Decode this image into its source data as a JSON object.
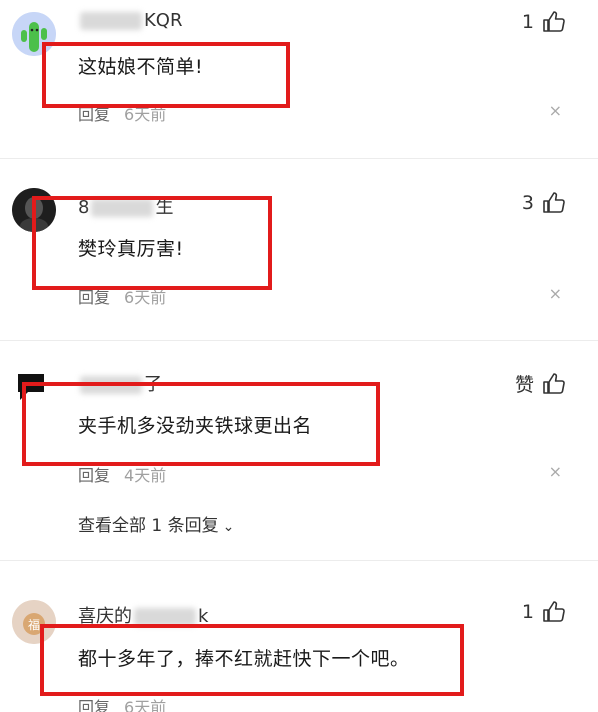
{
  "comments": [
    {
      "username_visible": "KQR",
      "text": "这姑娘不简单!",
      "likes": "1",
      "reply_label": "回复",
      "time": "6天前",
      "close": "×"
    },
    {
      "username_visible_prefix": "8",
      "username_visible_suffix": "生",
      "text": "樊玲真厉害!",
      "likes": "3",
      "reply_label": "回复",
      "time": "6天前",
      "close": "×"
    },
    {
      "username_visible_prefix": "",
      "username_visible_suffix": "了",
      "text": "夹手机多没劲夹铁球更出名",
      "likes": "赞",
      "reply_label": "回复",
      "time": "4天前",
      "close": "×",
      "view_replies": "查看全部 1 条回复"
    },
    {
      "username_visible_prefix": "喜庆的",
      "username_visible_suffix": "k",
      "text": "都十多年了，捧不红就赶快下一个吧。",
      "likes": "1",
      "reply_label": "回复",
      "time": "6天前"
    }
  ],
  "colors": {
    "highlight": "#e21b1b",
    "meta": "#8a8a8a"
  },
  "icons": {
    "like": "thumbs-up-icon",
    "close": "close-icon",
    "chevron": "chevron-down-icon"
  }
}
